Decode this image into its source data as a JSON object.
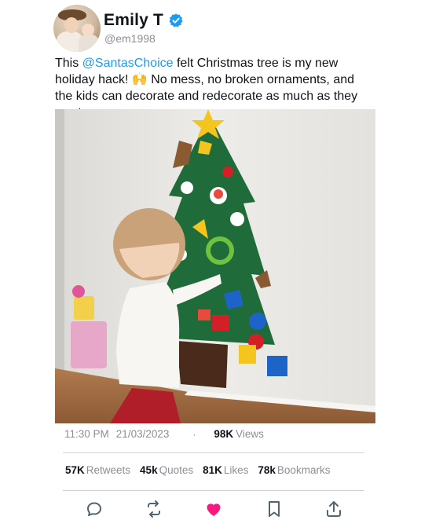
{
  "user": {
    "display_name": "Emily T",
    "handle": "@em1998",
    "verified": true,
    "avatar_icon": "profile-avatar"
  },
  "tweet": {
    "text_before": "This ",
    "mention": "@SantasChoice",
    "text_after": " felt Christmas tree is my new holiday hack! 🙌 No mess, no broken ornaments, and the kids can decorate and redecorate as much as they want.",
    "image_alt": "Toddler decorating a felt Christmas tree on a wall"
  },
  "meta": {
    "time": "11:30 PM",
    "date": "21/03/2023",
    "separator": "·",
    "views_count": "98K",
    "views_label": "Views"
  },
  "stats": {
    "retweets_count": "57K",
    "retweets_label": "Retweets",
    "quotes_count": "45k",
    "quotes_label": "Quotes",
    "likes_count": "81K",
    "likes_label": "Likes",
    "bookmarks_count": "78k",
    "bookmarks_label": "Bookmarks"
  },
  "actions": {
    "reply_icon": "reply-icon",
    "retweet_icon": "retweet-icon",
    "like_icon": "heart-icon",
    "bookmark_icon": "bookmark-icon",
    "share_icon": "share-icon"
  },
  "colors": {
    "mention": "#1d9bf0",
    "verified": "#1d9bf0",
    "like": "#f91880",
    "secondary_text": "#8a8f94"
  }
}
